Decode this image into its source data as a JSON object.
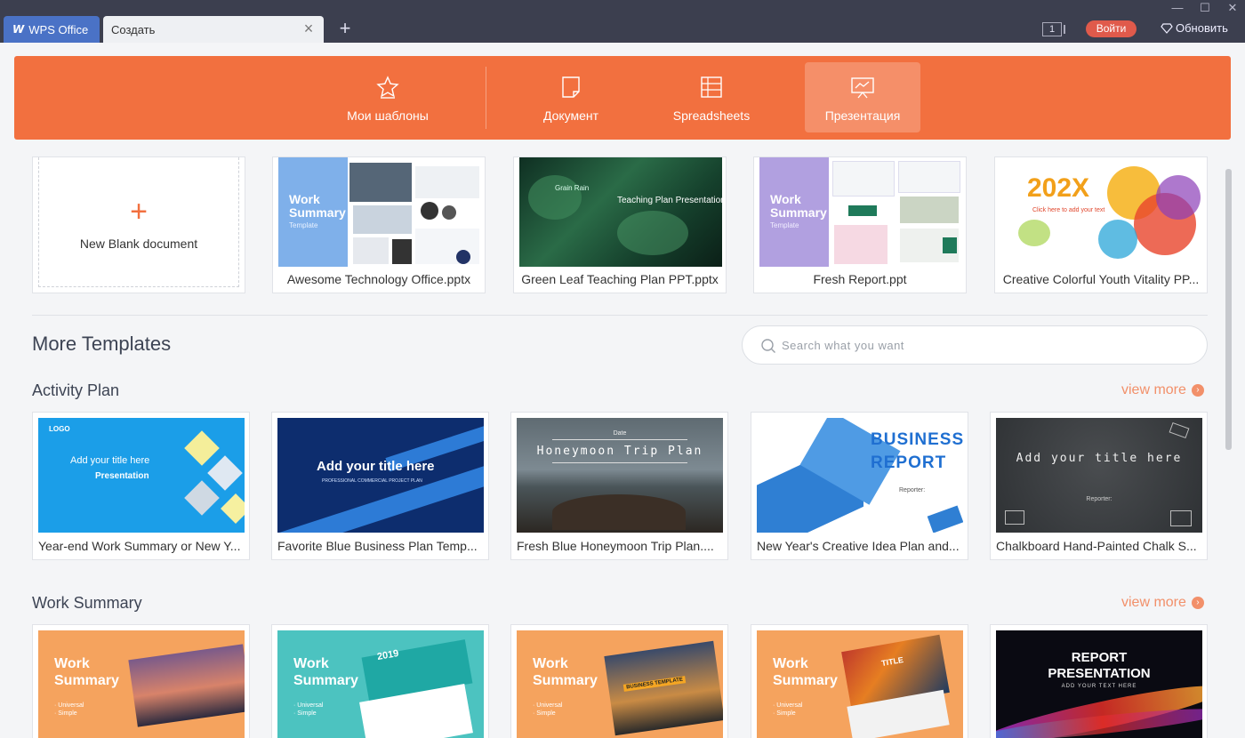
{
  "titlebar": {
    "app_tab": "WPS Office",
    "app_logo": "W",
    "doc_tab": "Создать",
    "close_glyph": "×",
    "new_tab_glyph": "+",
    "badge_number": "1",
    "login_label": "Войти",
    "update_label": "Обновить",
    "minimize_glyph": "—",
    "maximize_glyph": "☐",
    "window_close_glyph": "✕"
  },
  "categories": [
    {
      "label": "Мои шаблоны",
      "icon": "star-icon"
    },
    {
      "label": "Документ",
      "icon": "document-icon"
    },
    {
      "label": "Spreadsheets",
      "icon": "spreadsheet-icon"
    },
    {
      "label": "Презентация",
      "icon": "presentation-icon",
      "active": true
    }
  ],
  "recent": {
    "blank_plus": "+",
    "blank_label": "New Blank document",
    "items": [
      {
        "caption": "Awesome Technology Office.pptx",
        "thumb_text": "Work\nSummary",
        "thumb_sub": "Template"
      },
      {
        "caption": "Green Leaf Teaching Plan PPT.pptx",
        "thumb_text": "Teaching Plan Presentation",
        "thumb_sub": "Grain Rain"
      },
      {
        "caption": "Fresh Report.ppt",
        "thumb_text": "Work\nSummary",
        "thumb_sub": "Template"
      },
      {
        "caption": "Creative Colorful Youth Vitality PP...",
        "thumb_text": "202X",
        "thumb_sub": "Click here to add your text"
      }
    ]
  },
  "more_templates": {
    "title": "More Templates",
    "search_placeholder": "Search what you want"
  },
  "sections": [
    {
      "title": "Activity Plan",
      "view_more": "view more",
      "arrow": "›",
      "items": [
        {
          "caption": "Year-end Work Summary or New Y...",
          "thumb_title": "Add your title here",
          "thumb_sub": "Presentation",
          "thumb_logo": "LOGO"
        },
        {
          "caption": "Favorite Blue Business Plan Temp...",
          "thumb_title": "Add  your title here",
          "thumb_sub": "PROFESSIONAL COMMERCIAL PROJECT PLAN"
        },
        {
          "caption": "Fresh Blue Honeymoon Trip Plan....",
          "thumb_title": "Honeymoon Trip Plan",
          "thumb_sub": "Date"
        },
        {
          "caption": "New Year's Creative Idea Plan and...",
          "thumb_title": "BUSINESS\nREPORT",
          "thumb_sub": "Reporter:"
        },
        {
          "caption": "Chalkboard Hand-Painted Chalk S...",
          "thumb_title": "Add  your title here",
          "thumb_sub": "Reporter:"
        }
      ]
    },
    {
      "title": "Work Summary",
      "view_more": "view more",
      "arrow": "›",
      "items": [
        {
          "thumb_title": "Work\nSummary",
          "thumb_sub": "· Universal\n· Simple"
        },
        {
          "thumb_title": "Work\nSummary",
          "thumb_sub": "· Universal\n· Simple",
          "badge": "2019"
        },
        {
          "thumb_title": "Work\nSummary",
          "thumb_sub": "· Universal\n· Simple",
          "badge": "BUSINESS TEMPLATE"
        },
        {
          "thumb_title": "Work\nSummary",
          "thumb_sub": "· Universal\n· Simple",
          "badge": "TITLE"
        },
        {
          "thumb_title": "REPORT\nPRESENTATION",
          "thumb_sub": "ADD YOUR TEXT HERE"
        }
      ]
    }
  ],
  "colors": {
    "accent": "#f2703f",
    "titlebar": "#3c3f4f",
    "app_tab": "#4a72c6",
    "login": "#e05a4b"
  }
}
